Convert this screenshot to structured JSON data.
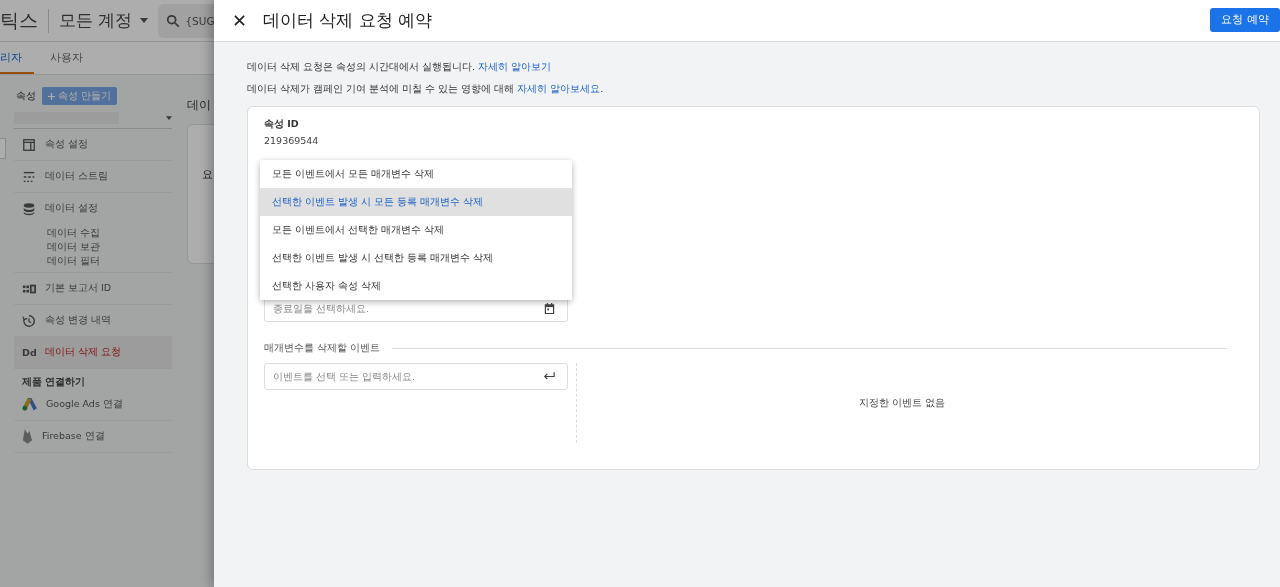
{
  "background_app": {
    "header": {
      "product_title": "틱스",
      "account_selector": "모든 계정",
      "search": {
        "value": "{SUG"
      }
    },
    "tabs": [
      {
        "label": "리자",
        "selected": true
      },
      {
        "label": "사용자",
        "selected": false
      }
    ],
    "property": {
      "label": "속성",
      "create_button": "속성 만들기"
    },
    "sidebar": {
      "items": [
        {
          "label": "속성 설정",
          "selected": false
        },
        {
          "label": "데이터 스트림",
          "selected": false
        },
        {
          "label": "데이터 설정",
          "selected": false,
          "children": [
            {
              "label": "데이터 수집"
            },
            {
              "label": "데이터 보관"
            },
            {
              "label": "데이터 필터"
            }
          ]
        },
        {
          "label": "기본 보고서 ID",
          "selected": false
        },
        {
          "label": "속성 변경 내역",
          "selected": false
        },
        {
          "label": "데이터 삭제 요청",
          "icon_text": "Dd",
          "selected": true
        }
      ],
      "section_title": "제품 연결하기",
      "links": [
        {
          "label": "Google Ads 연결"
        },
        {
          "label": "Firebase 연결"
        }
      ]
    },
    "content": {
      "title": "데이",
      "card_header": "요"
    }
  },
  "panel": {
    "title": "데이터 삭제 요청 예약",
    "primary_button": "요청 예약",
    "notes": [
      {
        "text": "데이터 삭제 요청은 속성의 시간대에서 실행됩니다. ",
        "link": "자세히 알아보기"
      },
      {
        "text": "데이터 삭제가 캠페인 기여 분석에 미칠 수 있는 영향에 대해 ",
        "link": "자세히 알아보세요",
        "after": "."
      }
    ],
    "card": {
      "property_id_label": "속성 ID",
      "property_id": "219369544",
      "menu": [
        {
          "label": "모든 이벤트에서 모든 매개변수 삭제",
          "selected": false
        },
        {
          "label": "선택한 이벤트 발생 시 모든 등록 매개변수 삭제",
          "selected": true
        },
        {
          "label": "모든 이벤트에서 선택한 매개변수 삭제",
          "selected": false
        },
        {
          "label": "선택한 이벤트 발생 시 선택한 등록 매개변수 삭제",
          "selected": false
        },
        {
          "label": "선택한 사용자 속성 삭제",
          "selected": false
        }
      ],
      "end_date_field": {
        "placeholder": "종료일을 선택하세요."
      },
      "events_section": {
        "title": "매개변수를 삭제할 이벤트",
        "input": {
          "placeholder": "이벤트를 선택 또는 입력하세요."
        },
        "empty_text": "지정한 이벤트 없음"
      }
    }
  }
}
